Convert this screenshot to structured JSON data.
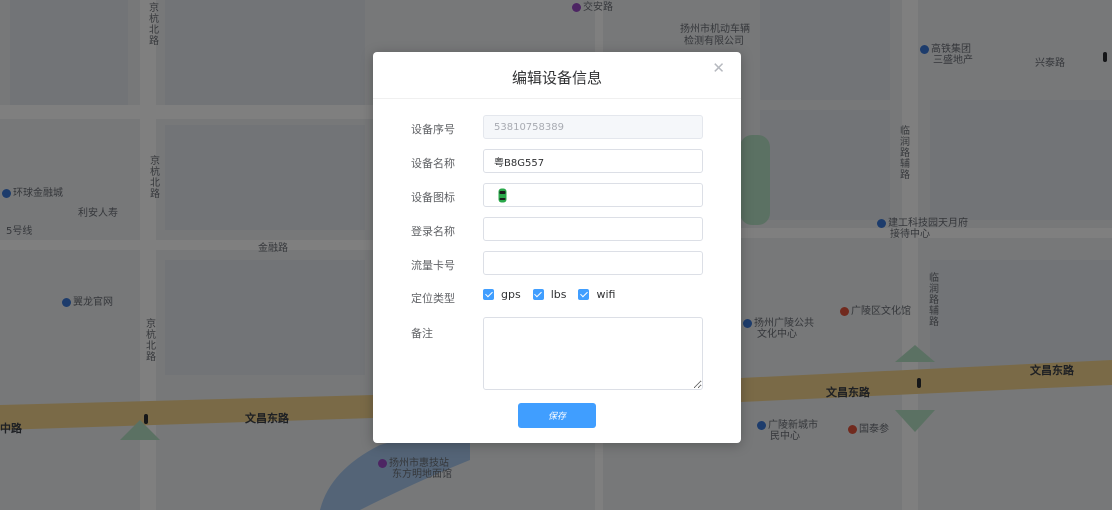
{
  "map": {
    "labels": [
      "京杭北路",
      "交安路",
      "扬州市机动车辆",
      "检测有限公司",
      "高铁集团",
      "三盛地产",
      "兴泰路",
      "环球金融城",
      "利安人寿",
      "金融路",
      "京杭北路",
      "临润路辅路",
      "建工科技园天月府",
      "接待中心",
      "翼龙官网",
      "京杭北路",
      "广陵区文化馆",
      "扬州广陵公共",
      "文化中心",
      "临润路辅路",
      "文昌东路",
      "文昌东路",
      "文昌东路",
      "广陵新城市",
      "民中心",
      "国泰参",
      "扬州市惠技站",
      "东方明地面馆",
      "中路",
      "5号线"
    ]
  },
  "dialog": {
    "title": "编辑设备信息",
    "close_icon": "close-icon",
    "fields": {
      "serial": {
        "label": "设备序号",
        "value": "53810758389"
      },
      "name": {
        "label": "设备名称",
        "value": "粤B8G557"
      },
      "icon": {
        "label": "设备图标",
        "icon": "car-icon",
        "icon_color": "#2aa84a"
      },
      "login": {
        "label": "登录名称",
        "value": ""
      },
      "sim": {
        "label": "流量卡号",
        "value": ""
      },
      "locate": {
        "label": "定位类型"
      },
      "remark": {
        "label": "备注",
        "value": ""
      }
    },
    "location_types": [
      {
        "label": "gps",
        "checked": true
      },
      {
        "label": "lbs",
        "checked": true
      },
      {
        "label": "wifi",
        "checked": true
      }
    ],
    "save_label": "保存"
  },
  "colors": {
    "primary": "#409eff",
    "overlay": "rgba(0,0,0,0.5)",
    "road": "#f5d58e",
    "water": "#a8c9ee",
    "park": "#b7e2c6"
  }
}
